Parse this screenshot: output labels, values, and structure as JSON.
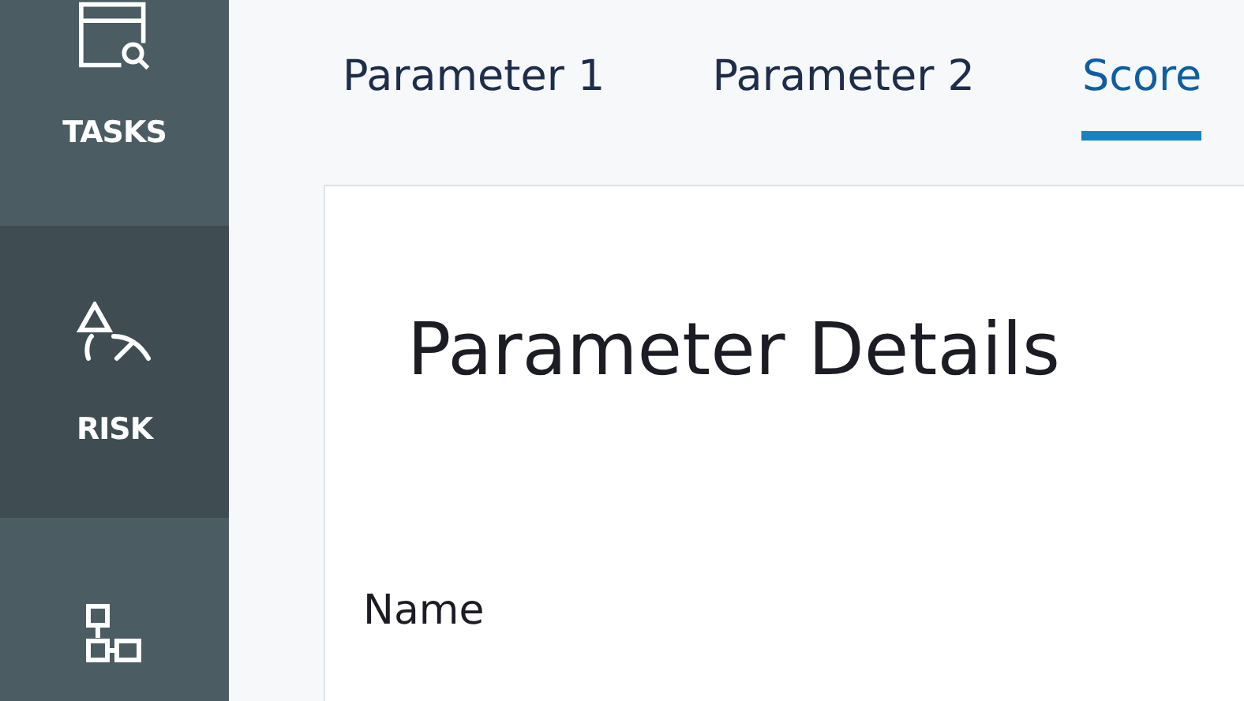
{
  "sidebar": {
    "items": [
      {
        "kind": "tasks",
        "label": "TASKS",
        "selected": false
      },
      {
        "kind": "risk",
        "label": "RISK",
        "selected": true
      },
      {
        "kind": "diagram",
        "selected": false
      }
    ]
  },
  "tabs": [
    {
      "label": "Parameter 1",
      "selected": false
    },
    {
      "label": "Parameter 2",
      "selected": false
    },
    {
      "label": "Score",
      "selected": true
    }
  ],
  "card": {
    "title": "Parameter Details",
    "field_label": "Name"
  }
}
